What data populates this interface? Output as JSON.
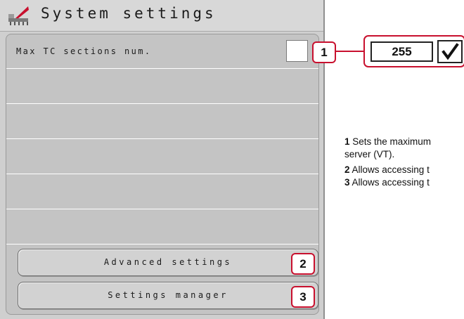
{
  "screen": {
    "title": "System settings",
    "rows": [
      {
        "label": "Max TC sections num."
      },
      {
        "label": ""
      },
      {
        "label": ""
      },
      {
        "label": ""
      },
      {
        "label": ""
      },
      {
        "label": ""
      }
    ],
    "buttons": {
      "advanced_label": "Advanced settings",
      "manager_label": "Settings manager"
    }
  },
  "badges": [
    "1",
    "2",
    "3"
  ],
  "callout": {
    "value": "255"
  },
  "descriptions": [
    {
      "num": "1",
      "text": " Sets the maximum"
    },
    {
      "num": "",
      "text": "server (VT)."
    },
    {
      "num": "2",
      "text": " Allows accessing t"
    },
    {
      "num": "3",
      "text": " Allows accessing t"
    }
  ],
  "colors": {
    "accent": "#c8102e",
    "screen_bg": "#cfcfcf"
  }
}
